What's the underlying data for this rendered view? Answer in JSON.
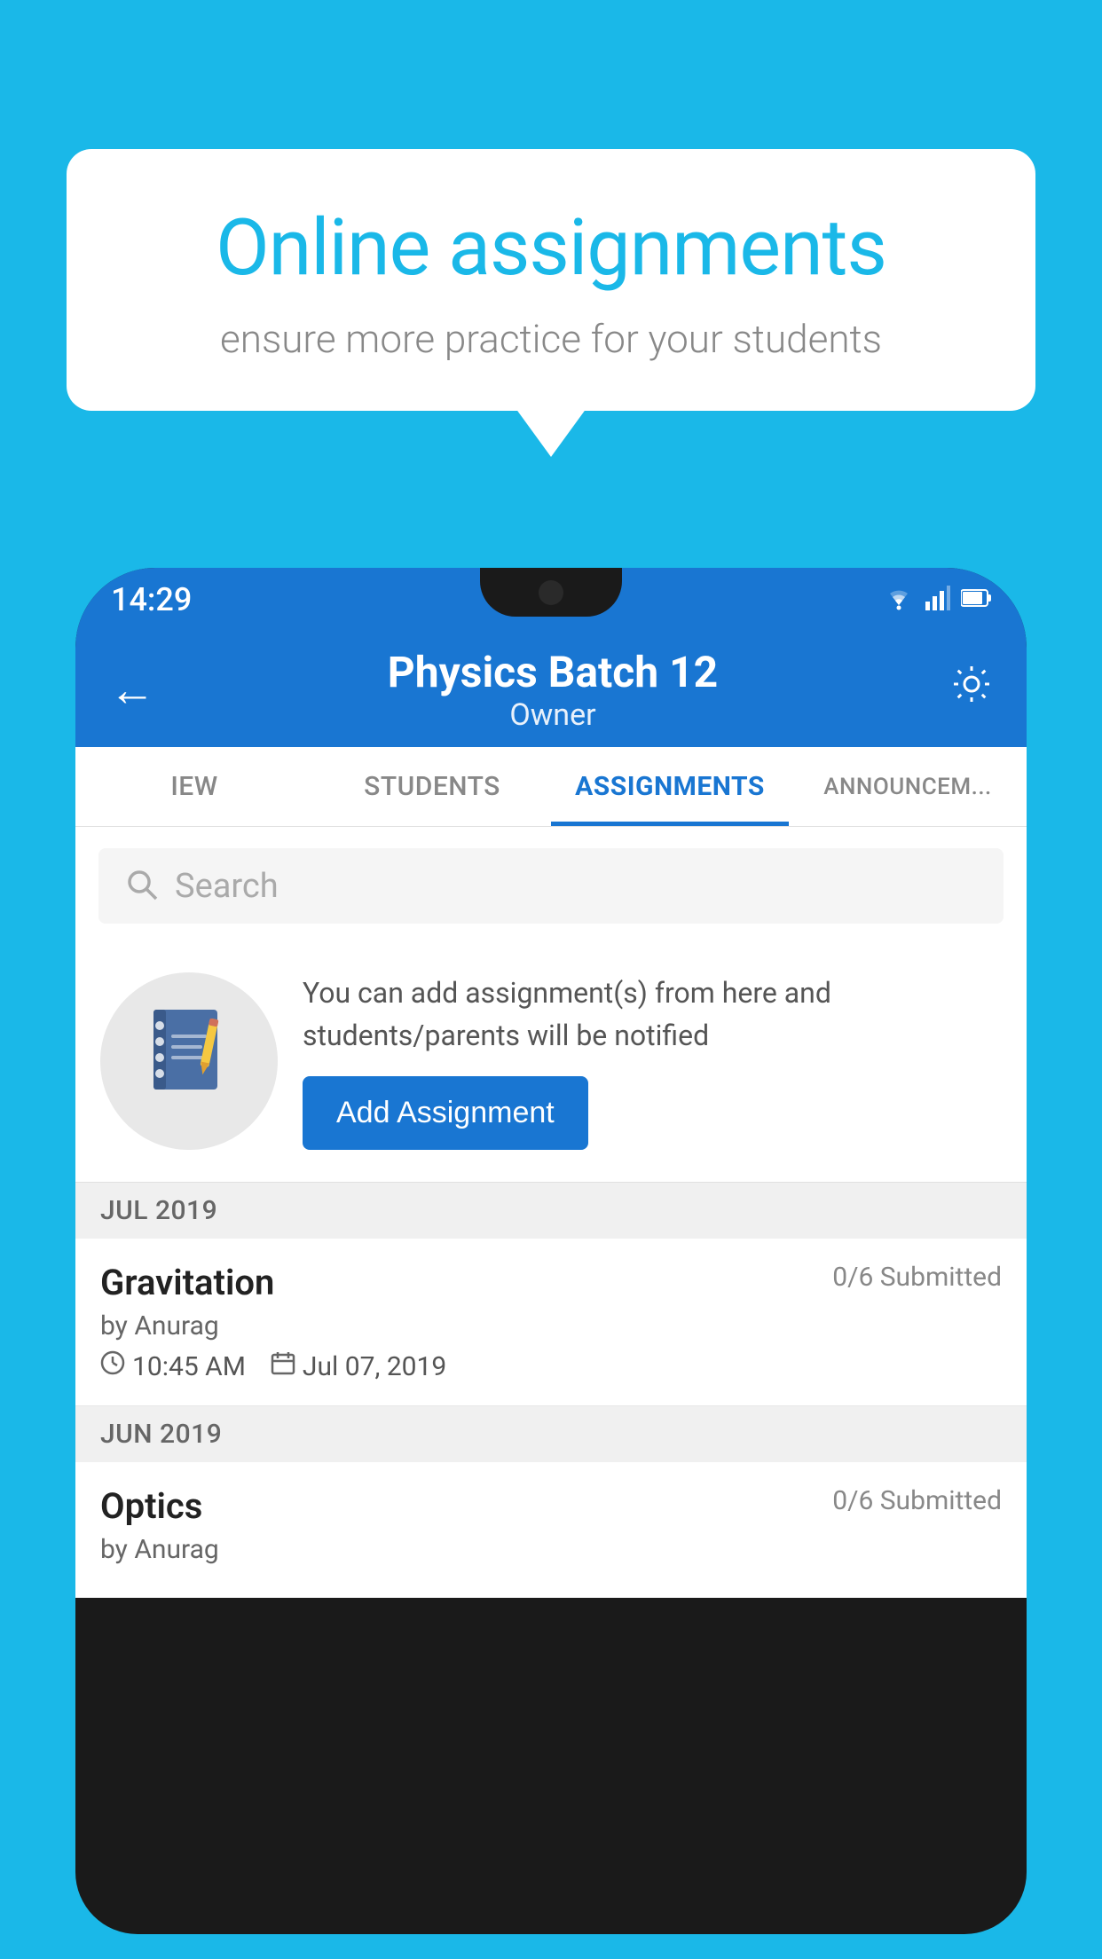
{
  "background_color": "#1ab8e8",
  "speech_bubble": {
    "title": "Online assignments",
    "subtitle": "ensure more practice for your students"
  },
  "status_bar": {
    "time": "14:29",
    "wifi": "▾",
    "signal": "▲",
    "battery": "▮"
  },
  "app_header": {
    "title": "Physics Batch 12",
    "subtitle": "Owner",
    "back_label": "←",
    "settings_label": "⚙"
  },
  "tabs": [
    {
      "label": "IEW",
      "active": false
    },
    {
      "label": "STUDENTS",
      "active": false
    },
    {
      "label": "ASSIGNMENTS",
      "active": true
    },
    {
      "label": "ANNOUNCEM...",
      "active": false
    }
  ],
  "search": {
    "placeholder": "Search"
  },
  "promo": {
    "text": "You can add assignment(s) from here and students/parents will be notified",
    "button_label": "Add Assignment"
  },
  "sections": [
    {
      "month": "JUL 2019",
      "assignments": [
        {
          "title": "Gravitation",
          "submitted": "0/6 Submitted",
          "by": "by Anurag",
          "time": "10:45 AM",
          "date": "Jul 07, 2019"
        }
      ]
    },
    {
      "month": "JUN 2019",
      "assignments": [
        {
          "title": "Optics",
          "submitted": "0/6 Submitted",
          "by": "by Anurag",
          "time": "",
          "date": ""
        }
      ]
    }
  ]
}
